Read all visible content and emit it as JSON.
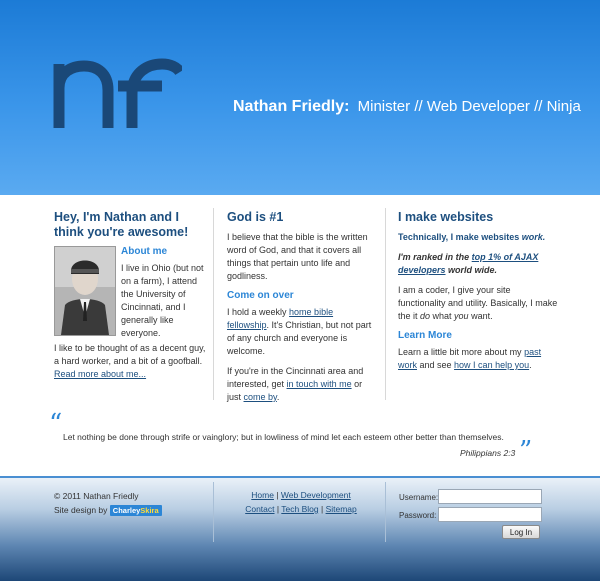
{
  "header": {
    "name": "Nathan Friedly:",
    "roles": "Minister // Web Developer // Ninja"
  },
  "col1": {
    "title": "Hey, I'm Nathan and I think you're awesome!",
    "about_title": "About me",
    "about_text": "I live in Ohio (but not on a farm), I attend the University of Cincinnati, and I generally like everyone.",
    "bio": "I like to be thought of as a decent guy, a hard worker, and a bit of a goofball.",
    "read_more": "Read more about me..."
  },
  "col2": {
    "title": "God is #1",
    "p1": "I believe that the bible is the written word of God, and that it covers all things that pertain unto life and godliness.",
    "come_title": "Come on over",
    "p2_a": "I hold a weekly ",
    "p2_link": "home bible fellowship",
    "p2_b": ". It's Christian, but not part of any church and everyone is welcome.",
    "p3_a": "If you're in the Cincinnati area and interested, get ",
    "p3_link1": "in touch with me",
    "p3_b": " or just ",
    "p3_link2": "come by",
    "p3_c": "."
  },
  "col3": {
    "title": "I make websites",
    "tech_a": "Technically, I make websites ",
    "tech_b": "work.",
    "rank_a": "I'm ranked in the ",
    "rank_link": "top 1% of AJAX developers",
    "rank_b": " world wide.",
    "p1_a": "I am a coder, I give your site functionality and utility. Basically, I make the it ",
    "p1_do": "do",
    "p1_b": " what ",
    "p1_you": "you",
    "p1_c": " want.",
    "learn_title": "Learn More",
    "p2_a": "Learn a little bit more about my ",
    "p2_link1": "past work",
    "p2_b": " and see ",
    "p2_link2": "how I can help you",
    "p2_c": "."
  },
  "quote": {
    "open_mark": "“",
    "close_mark": "”",
    "text": "Let nothing be done through strife or vainglory; but in lowliness of mind let each esteem other better than themselves.",
    "reference": "Philippians 2:3"
  },
  "footer": {
    "copyright": "© 2011 Nathan Friedly",
    "design_by": "Site design by",
    "designer_a": "Charley",
    "designer_b": "Skira",
    "links_row1": [
      "Home",
      "Web Development"
    ],
    "links_row2": [
      "Contact",
      "Tech Blog",
      "Sitemap"
    ],
    "sep": " | ",
    "username_label": "Username:",
    "password_label": "Password:",
    "login_button": "Log In"
  },
  "colors": {
    "header_blue": "#3b96ea",
    "logo_navy": "#1a4878",
    "heading_navy": "#1d4f7f",
    "accent_blue": "#2c86d6"
  }
}
